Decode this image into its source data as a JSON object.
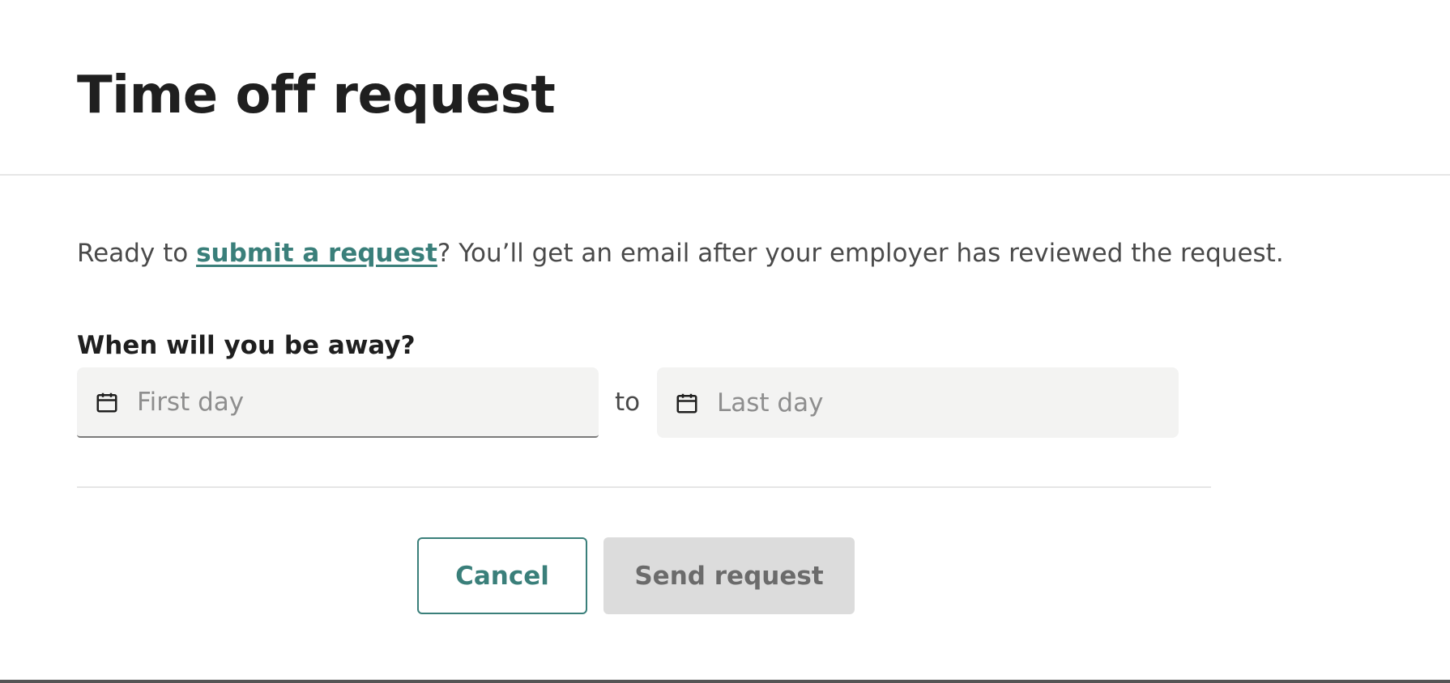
{
  "header": {
    "title": "Time off request"
  },
  "intro": {
    "prefix": "Ready to ",
    "link_text": "submit a request",
    "suffix": "? You’ll get an email after your employer has reviewed the request."
  },
  "dates": {
    "label": "When will you be away?",
    "first_placeholder": "First day",
    "first_value": "",
    "separator": "to",
    "last_placeholder": "Last day",
    "last_value": "",
    "icon": "calendar-icon"
  },
  "actions": {
    "cancel_label": "Cancel",
    "send_label": "Send request"
  },
  "colors": {
    "accent": "#3a7f7a",
    "input_bg": "#f3f3f2",
    "disabled_bg": "#dcdcdc"
  }
}
